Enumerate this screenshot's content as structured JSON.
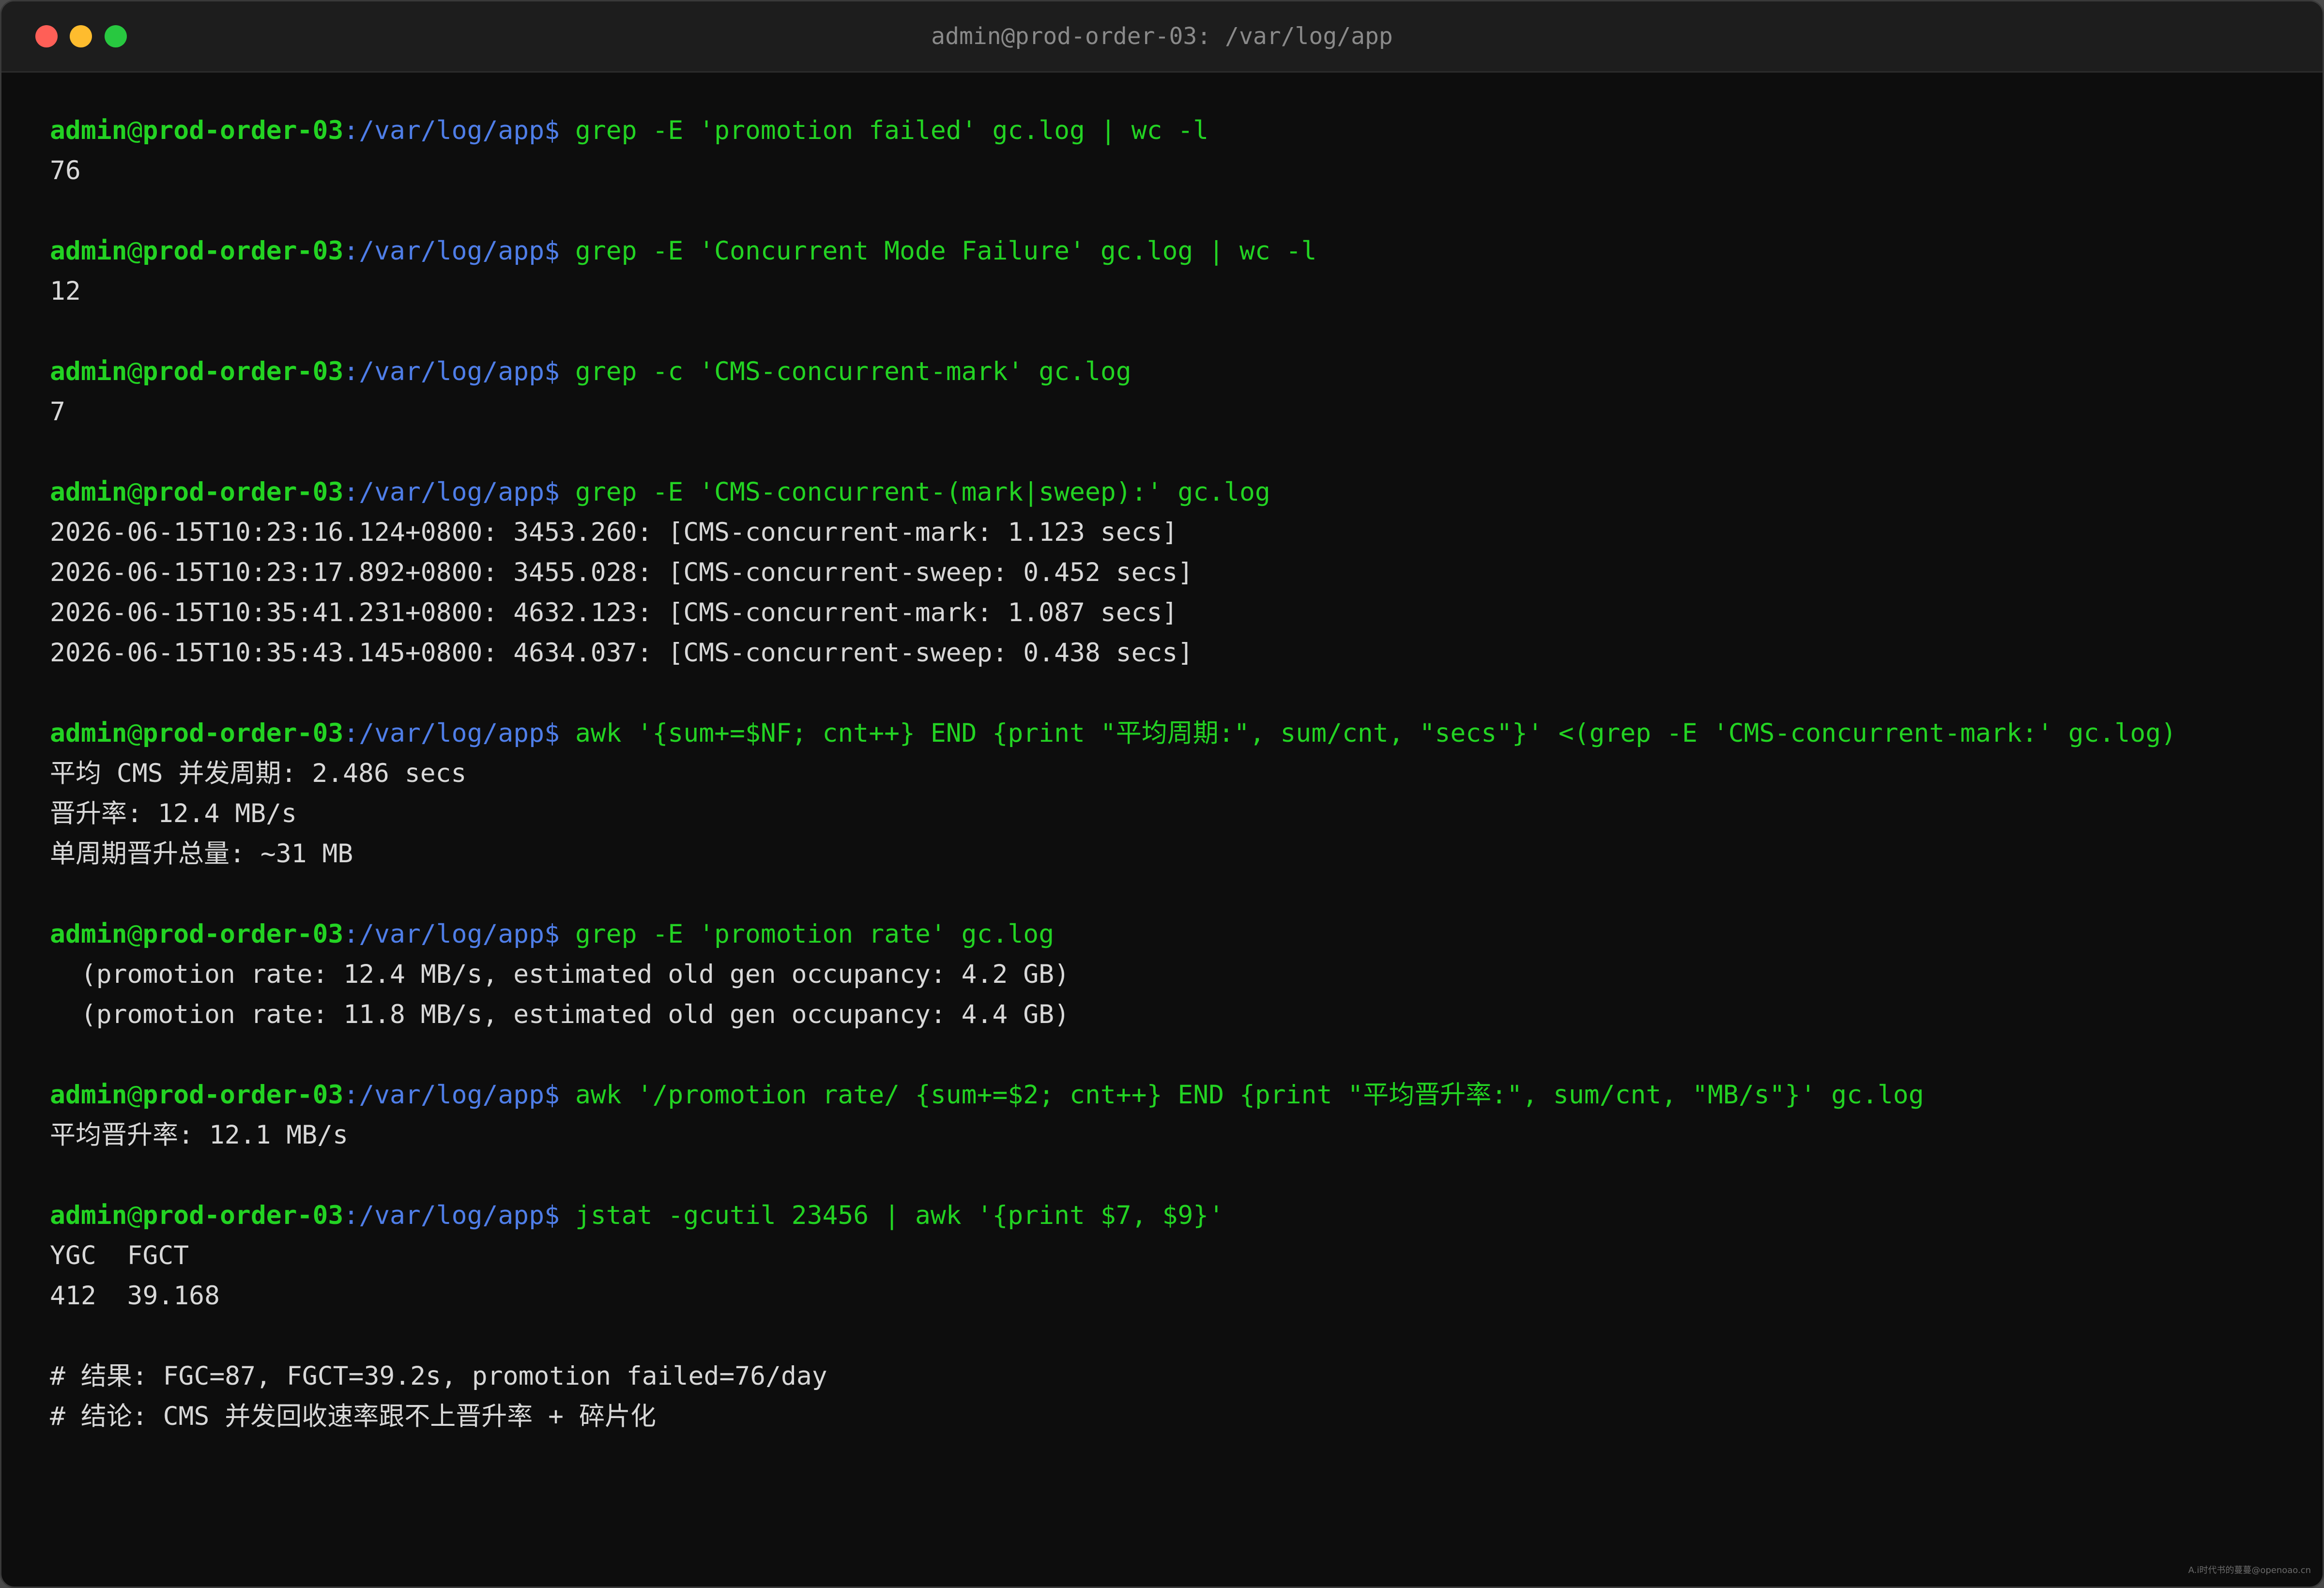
{
  "window": {
    "title": "admin@prod-order-03: /var/log/app"
  },
  "prompt": {
    "user": "admin",
    "at": "@",
    "host": "prod-order-03",
    "colon": ":",
    "path": "/var/log/app",
    "dollar": "$ "
  },
  "blocks": [
    {
      "command": "grep -E 'promotion failed' gc.log | wc -l",
      "output": [
        "76"
      ]
    },
    {
      "command": "grep -E 'Concurrent Mode Failure' gc.log | wc -l",
      "output": [
        "12"
      ]
    },
    {
      "command": "grep -c 'CMS-concurrent-mark' gc.log",
      "output": [
        "7"
      ]
    },
    {
      "command": "grep -E 'CMS-concurrent-(mark|sweep):' gc.log",
      "output": [
        "2026-06-15T10:23:16.124+0800: 3453.260: [CMS-concurrent-mark: 1.123 secs]",
        "2026-06-15T10:23:17.892+0800: 3455.028: [CMS-concurrent-sweep: 0.452 secs]",
        "2026-06-15T10:35:41.231+0800: 4632.123: [CMS-concurrent-mark: 1.087 secs]",
        "2026-06-15T10:35:43.145+0800: 4634.037: [CMS-concurrent-sweep: 0.438 secs]"
      ]
    },
    {
      "command": "awk '{sum+=$NF; cnt++} END {print \"平均周期:\", sum/cnt, \"secs\"}' <(grep -E 'CMS-concurrent-mark:' gc.log)",
      "output": [
        "平均 CMS 并发周期: 2.486 secs",
        "晋升率: 12.4 MB/s",
        "单周期晋升总量: ~31 MB"
      ]
    },
    {
      "command": "grep -E 'promotion rate' gc.log",
      "output": [
        "  (promotion rate: 12.4 MB/s, estimated old gen occupancy: 4.2 GB)",
        "  (promotion rate: 11.8 MB/s, estimated old gen occupancy: 4.4 GB)"
      ]
    },
    {
      "command": "awk '/promotion rate/ {sum+=$2; cnt++} END {print \"平均晋升率:\", sum/cnt, \"MB/s\"}' gc.log",
      "output": [
        "平均晋升率: 12.1 MB/s"
      ]
    },
    {
      "command": "jstat -gcutil 23456 | awk '{print $7, $9}'",
      "output": [
        "YGC  FGCT",
        "412  39.168"
      ]
    }
  ],
  "comments": [
    "# 结果: FGC=87, FGCT=39.2s, promotion failed=76/day",
    "# 结论: CMS 并发回收速率跟不上晋升率 + 碎片化"
  ],
  "watermark": "A.i时代书的蔓蔓@openoao.cn",
  "colors": {
    "background": "#0d0d0d",
    "titlebar": "#1d1d1d",
    "prompt_green": "#23d323",
    "path_blue": "#4f7ee8",
    "output_text": "#d8d8d8",
    "close": "#ff5f57",
    "minimize": "#febc2e",
    "maximize": "#28c840"
  }
}
